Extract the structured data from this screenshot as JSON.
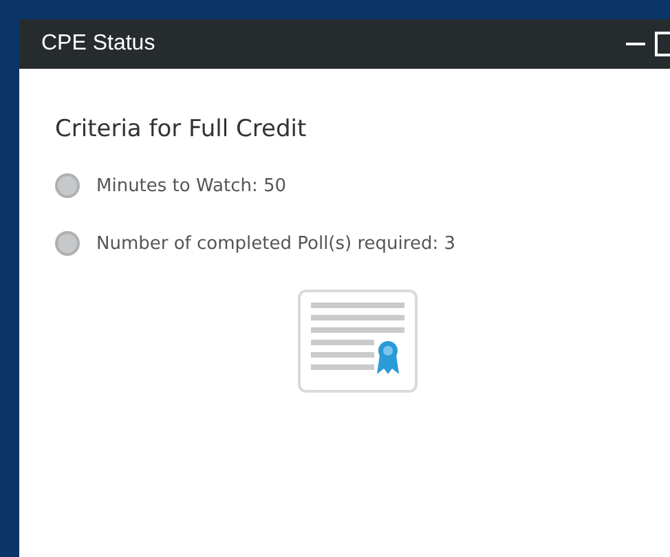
{
  "window": {
    "title": "CPE Status"
  },
  "heading": "Criteria for Full Credit",
  "criteria": [
    {
      "label": "Minutes to Watch: 50",
      "completed": false
    },
    {
      "label": "Number of completed Poll(s) required: 3",
      "completed": false
    }
  ]
}
